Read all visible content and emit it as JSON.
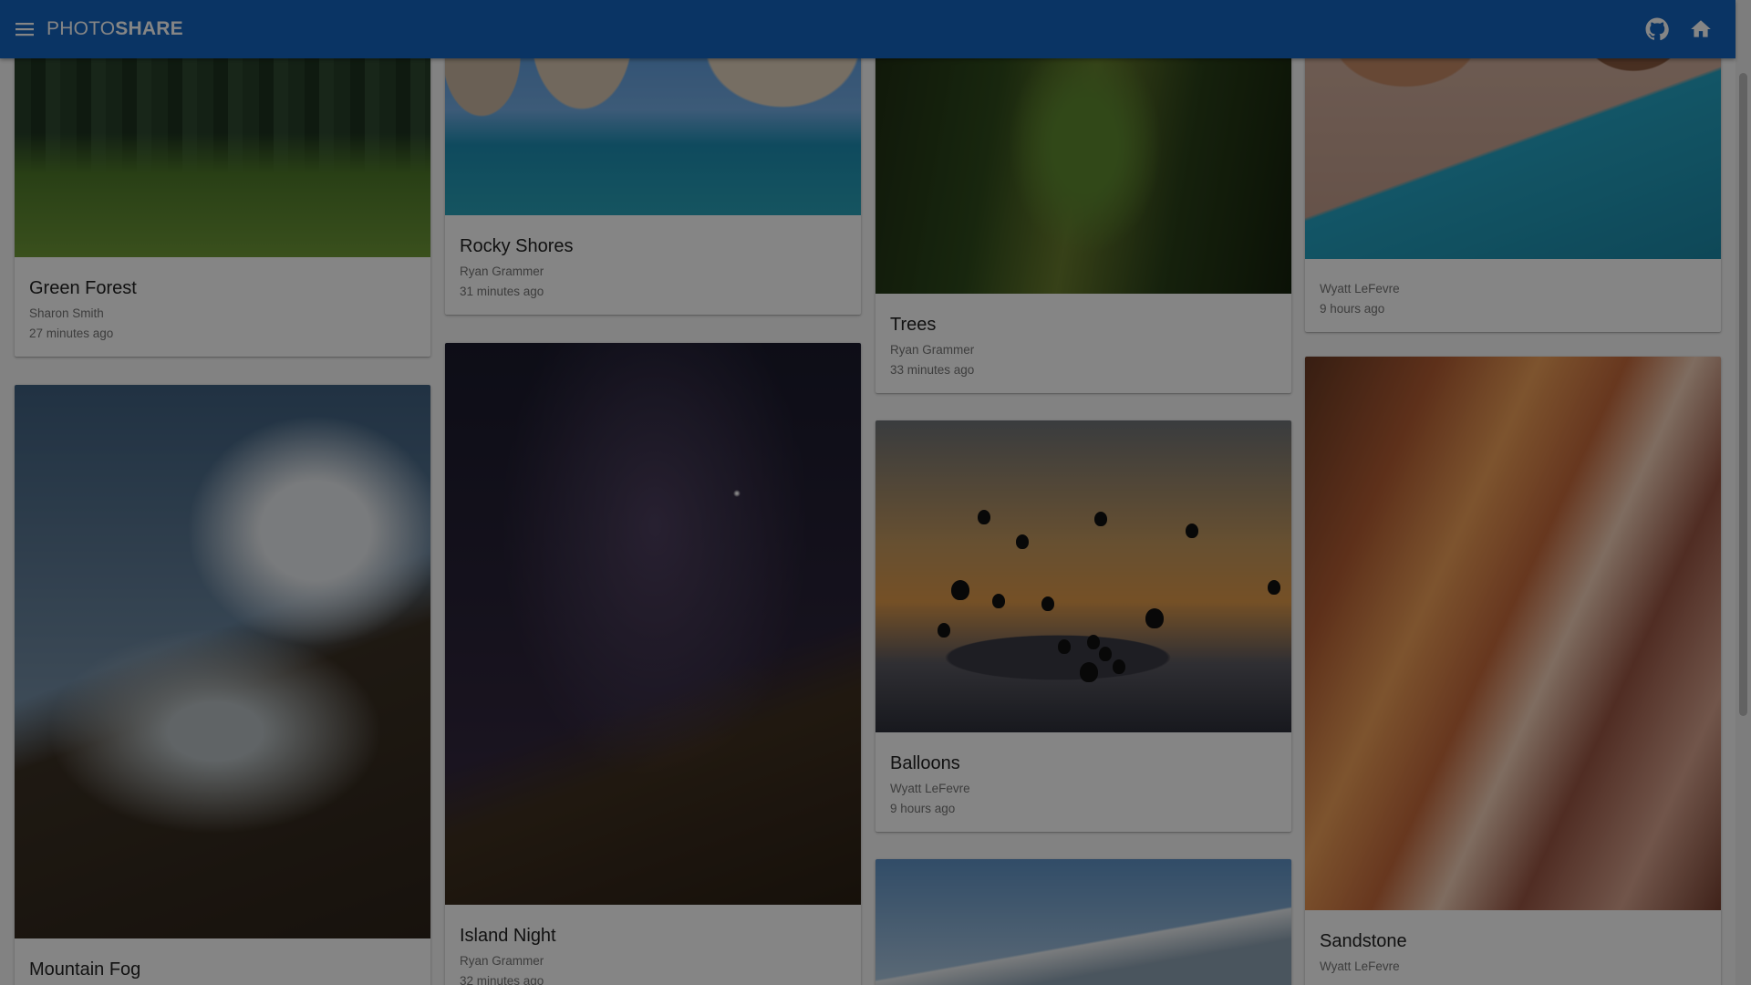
{
  "app": {
    "brand_light": "PHOTO",
    "brand_bold": "SHARE",
    "actions": [
      {
        "name": "github",
        "icon": "github-icon"
      },
      {
        "name": "home",
        "icon": "home-icon"
      }
    ],
    "menu_icon": "menu-icon",
    "colors": {
      "appbar": "#1565c0",
      "scrim": "rgba(0,0,0,0.48)"
    }
  },
  "photos": [
    {
      "id": "green-forest",
      "title": "Green Forest",
      "author": "Sharon Smith",
      "time": "27 minutes ago"
    },
    {
      "id": "rocky-shores",
      "title": "Rocky Shores",
      "author": "Ryan Grammer",
      "time": "31 minutes ago"
    },
    {
      "id": "trees",
      "title": "Trees",
      "author": "Ryan Grammer",
      "time": "33 minutes ago"
    },
    {
      "id": "beach",
      "title": "",
      "author": "Wyatt LeFevre",
      "time": "9 hours ago"
    },
    {
      "id": "mountain-fog",
      "title": "Mountain Fog",
      "author": "",
      "time": ""
    },
    {
      "id": "island-night",
      "title": "Island Night",
      "author": "Ryan Grammer",
      "time": "32 minutes ago"
    },
    {
      "id": "balloons",
      "title": "Balloons",
      "author": "Wyatt LeFevre",
      "time": "9 hours ago"
    },
    {
      "id": "mountain",
      "title": "",
      "author": "",
      "time": ""
    },
    {
      "id": "sandstone",
      "title": "Sandstone",
      "author": "Wyatt LeFevre",
      "time": ""
    }
  ]
}
